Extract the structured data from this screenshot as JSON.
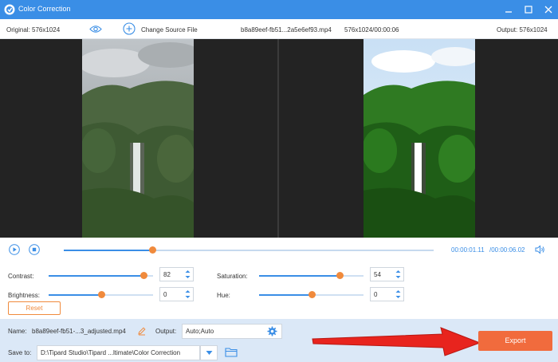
{
  "window": {
    "title": "Color Correction"
  },
  "info_bar": {
    "original_label": "Original: 576x1024",
    "change_source_label": "Change Source File",
    "file_name": "b8a89eef-fb51...2a5e6ef93.mp4",
    "resolution_time": "576x1024/00:00:06",
    "output_label": "Output: 576x1024"
  },
  "playback": {
    "current_time": "00:00:01.11",
    "total_time": "/00:00:06.02",
    "progress": 0.24
  },
  "adjustments": {
    "contrast": {
      "label": "Contrast:",
      "value": "82",
      "level": 0.91
    },
    "saturation": {
      "label": "Saturation:",
      "value": "54",
      "level": 0.77
    },
    "brightness": {
      "label": "Brightness:",
      "value": "0",
      "level": 0.5
    },
    "hue": {
      "label": "Hue:",
      "value": "0",
      "level": 0.5
    },
    "reset_label": "Reset"
  },
  "export_settings": {
    "name_label": "Name:",
    "name_value": "b8a89eef-fb51-...3_adjusted.mp4",
    "output_label": "Output:",
    "output_value": "Auto;Auto",
    "save_to_label": "Save to:",
    "save_to_value": "D:\\Tipard Studio\\Tipard ...ltimate\\Color Correction",
    "export_label": "Export"
  },
  "colors": {
    "accent": "#3a8ee6",
    "thumb": "#f08a3c",
    "export": "#f16b3d",
    "arrow": "#e8241e"
  }
}
